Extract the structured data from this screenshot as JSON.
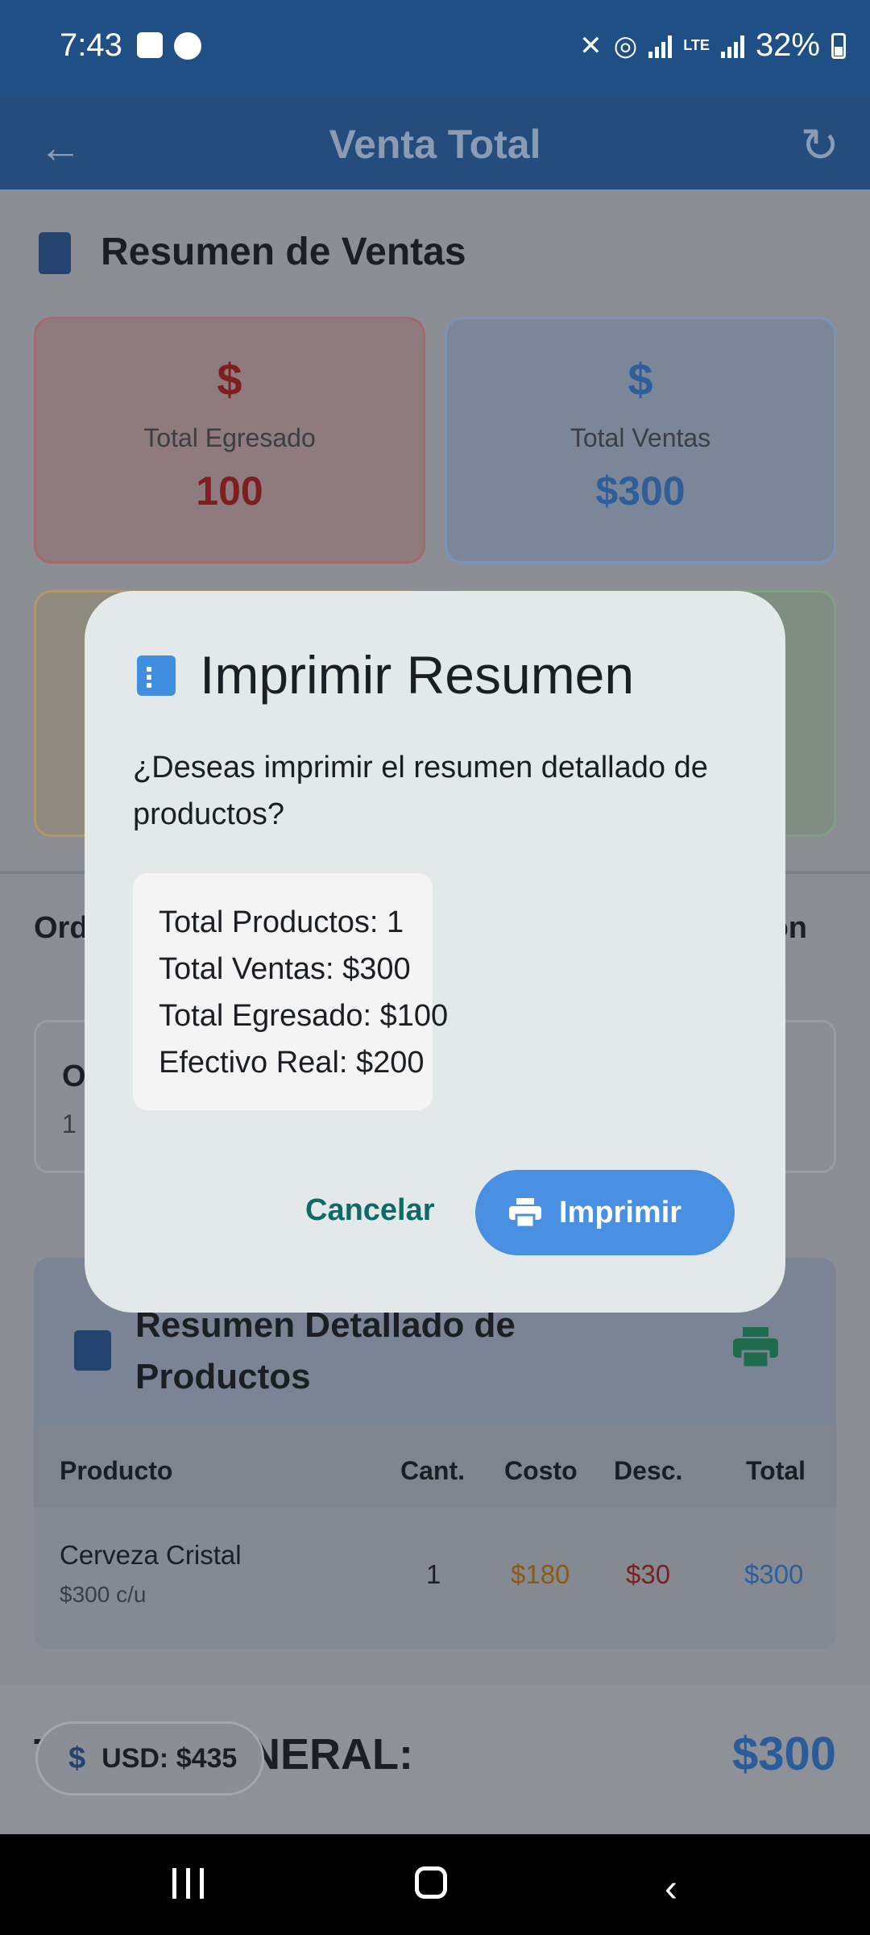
{
  "status_bar": {
    "time": "7:43",
    "battery": "32%"
  },
  "app_bar": {
    "title": "Venta Total"
  },
  "summary": {
    "title": "Resumen de Ventas",
    "cards": [
      {
        "symbol": "$",
        "label": "Total Egresado",
        "value": "100"
      },
      {
        "symbol": "$",
        "label": "Total Ventas",
        "value": "$300"
      }
    ]
  },
  "tabs": {
    "left_fragment": "Ord",
    "right_fragment": "on"
  },
  "order": {
    "title_fragment": "O",
    "sub_fragment": "1"
  },
  "detail": {
    "title": "Resumen Detallado de Productos",
    "headers": [
      "Producto",
      "Cant.",
      "Costo",
      "Desc.",
      "Total"
    ],
    "row": {
      "product": "Cerveza Cristal",
      "unit": "$300 c/u",
      "qty": "1",
      "cost": "$180",
      "discount": "$30",
      "total": "$300"
    }
  },
  "footer": {
    "total_label": "TOTAL GENERAL:",
    "total_value": "$300",
    "usd_chip": "USD: $435",
    "usd_symbol": "$"
  },
  "dialog": {
    "title": "Imprimir Resumen",
    "message": "¿Deseas imprimir el resumen detallado de productos?",
    "lines": [
      "Total Productos: 1",
      "Total Ventas: $300",
      "Total Egresado: $100",
      "Efectivo Real: $200"
    ],
    "cancel_label": "Cancelar",
    "print_label": "Imprimir"
  },
  "colors": {
    "app_bar": "#244c7d",
    "accent": "#4a90e2",
    "cancel": "#0f6a66"
  }
}
